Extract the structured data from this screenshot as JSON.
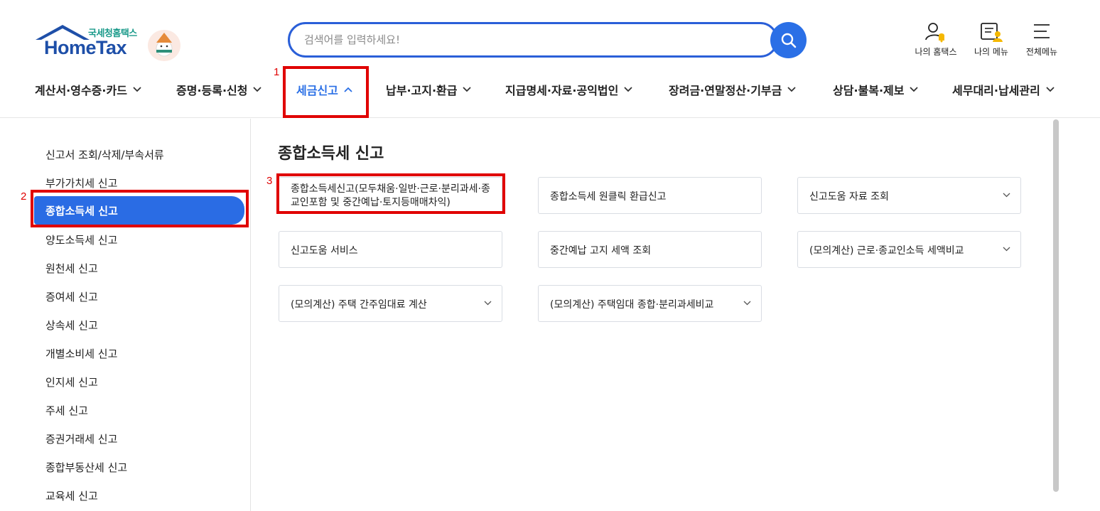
{
  "logo": {
    "small": "국세청홈택스",
    "big": "HomeTax"
  },
  "search": {
    "placeholder": "검색어를 입력하세요!"
  },
  "utilities": [
    {
      "label": "나의 홈택스",
      "icon": "user-bell-icon"
    },
    {
      "label": "나의 메뉴",
      "icon": "menu-user-icon"
    },
    {
      "label": "전체메뉴",
      "icon": "hamburger-icon"
    }
  ],
  "gnb": [
    {
      "label": "계산서·영수증·카드"
    },
    {
      "label": "증명·등록·신청"
    },
    {
      "label": "세금신고"
    },
    {
      "label": "납부·고지·환급"
    },
    {
      "label": "지급명세·자료·공익법인"
    },
    {
      "label": "장려금·연말정산·기부금"
    },
    {
      "label": "상담·불복·제보"
    },
    {
      "label": "세무대리·납세관리"
    }
  ],
  "annotations": [
    "1",
    "2",
    "3"
  ],
  "sidebar": {
    "items": [
      {
        "label": "신고서 조회/삭제/부속서류"
      },
      {
        "label": "부가가치세 신고"
      },
      {
        "label": "종합소득세 신고"
      },
      {
        "label": "양도소득세 신고"
      },
      {
        "label": "원천세 신고"
      },
      {
        "label": "증여세 신고"
      },
      {
        "label": "상속세 신고"
      },
      {
        "label": "개별소비세 신고"
      },
      {
        "label": "인지세 신고"
      },
      {
        "label": "주세 신고"
      },
      {
        "label": "증권거래세 신고"
      },
      {
        "label": "종합부동산세 신고"
      },
      {
        "label": "교육세 신고"
      }
    ]
  },
  "main": {
    "title": "종합소득세 신고",
    "cards": [
      {
        "label": "종합소득세신고(모두채움·일반·근로·분리과세·종교인포함 및 중간예납·토지등매매차익)"
      },
      {
        "label": "종합소득세 원클릭 환급신고"
      },
      {
        "label": "신고도움 자료 조회"
      },
      {
        "label": "신고도움 서비스"
      },
      {
        "label": "중간예납 고지 세액 조회"
      },
      {
        "label": "(모의계산) 근로·종교인소득 세액비교"
      },
      {
        "label": "(모의계산) 주택 간주임대료 계산"
      },
      {
        "label": "(모의계산) 주택임대 종합·분리과세비교"
      }
    ]
  },
  "colors": {
    "accent": "#2a6ce4",
    "highlight": "#e00000"
  }
}
